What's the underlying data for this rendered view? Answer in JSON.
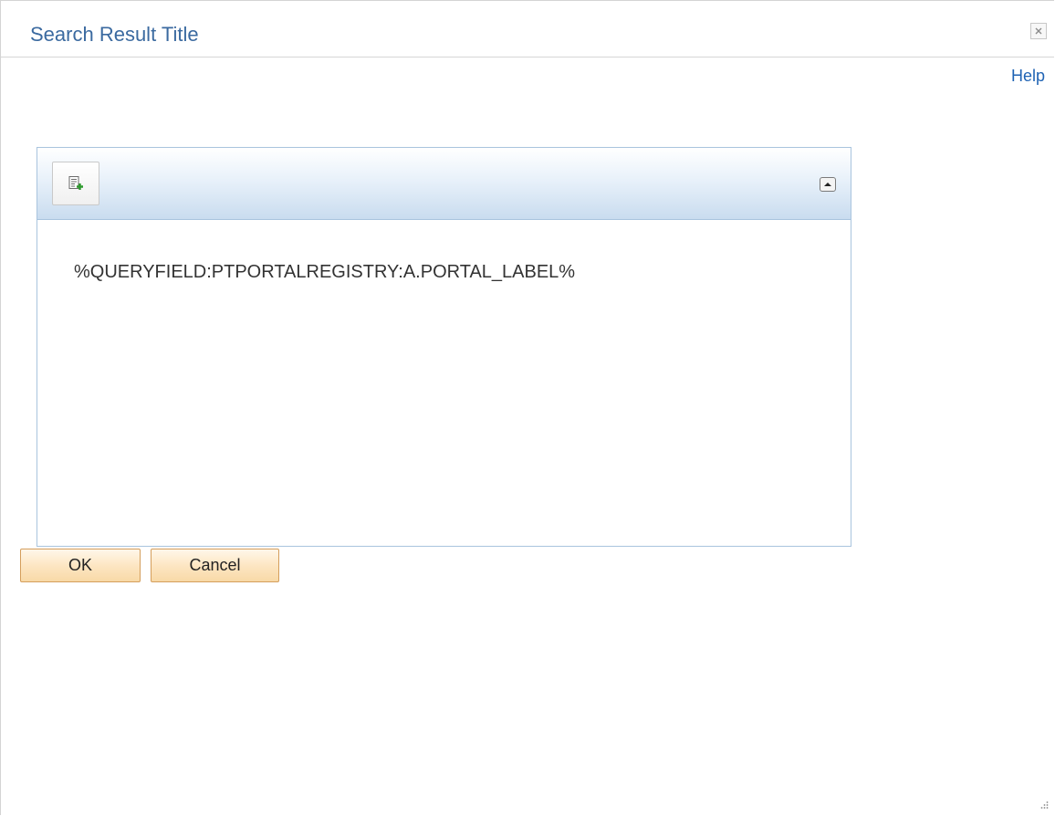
{
  "dialog": {
    "title": "Search Result Title",
    "close_icon": "close-icon"
  },
  "help": {
    "label": "Help"
  },
  "editor": {
    "add_field_icon": "add-field-icon",
    "collapse_icon": "collapse-up-icon",
    "field_text": "%QUERYFIELD:PTPORTALREGISTRY:A.PORTAL_LABEL%"
  },
  "buttons": {
    "ok_label": "OK",
    "cancel_label": "Cancel"
  },
  "colors": {
    "title": "#3b6aa0",
    "link": "#1f63b4",
    "panel_border": "#a9c4de",
    "button_border": "#d49e5c"
  }
}
